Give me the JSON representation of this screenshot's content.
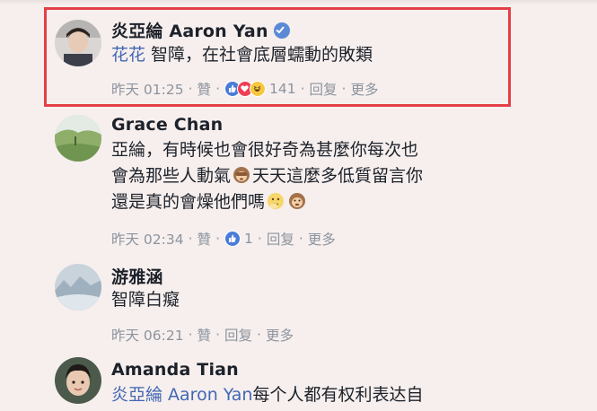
{
  "comments": [
    {
      "name": "炎亞綸 Aaron Yan",
      "verified": true,
      "mention": "花花",
      "text_lines": [
        " 智障，在社會底層蠕動的敗類"
      ],
      "time": "昨天 01:25",
      "like_label": "贊",
      "reaction_icons": [
        "like-icon",
        "love-icon",
        "haha-icon"
      ],
      "reaction_count": "141",
      "reply_label": "回复",
      "more_label": "更多",
      "highlighted": true
    },
    {
      "name": "Grace Chan",
      "text_lines": [
        "亞綸，有時候也會很好奇為甚麼你每次也",
        "會為那些人動氣",
        "天天這麼多低質留言你",
        "還是真的會燥他們嗎"
      ],
      "emojis": [
        "see-no-evil-monkey-emoji",
        "thinking-face-emoji",
        "monkey-emoji"
      ],
      "time": "昨天 02:34",
      "like_label": "贊",
      "reaction_icons": [
        "like-icon"
      ],
      "reaction_count": "1",
      "reply_label": "回复",
      "more_label": "更多"
    },
    {
      "name": "游雅涵",
      "text_lines": [
        "智障白癡"
      ],
      "time": "昨天 06:21",
      "like_label": "贊",
      "reply_label": "回复",
      "more_label": "更多"
    },
    {
      "name": "Amanda Tian",
      "mention": "炎亞綸 Aaron Yan",
      "text_lines": [
        "每个人都有权利表达自"
      ]
    }
  ],
  "colors": {
    "background": "#f6efee",
    "link_blue": "#4267b2",
    "meta_gray": "#8d949e",
    "highlight_red": "#e43f47"
  }
}
